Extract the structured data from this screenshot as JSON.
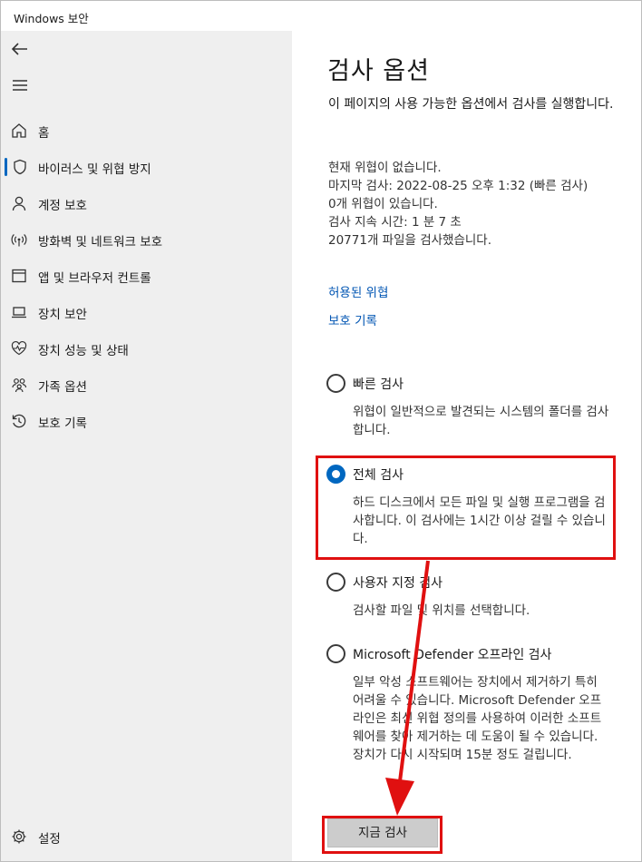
{
  "window": {
    "title": "Windows 보안"
  },
  "sidebar": {
    "back_icon": "back-arrow-icon",
    "menu_icon": "hamburger-menu-icon",
    "items": [
      {
        "label": "홈",
        "icon": "home-icon"
      },
      {
        "label": "바이러스 및 위협 방지",
        "icon": "shield-icon",
        "active": true
      },
      {
        "label": "계정 보호",
        "icon": "person-icon"
      },
      {
        "label": "방화벽 및 네트워크 보호",
        "icon": "wifi-antenna-icon"
      },
      {
        "label": "앱 및 브라우저 컨트롤",
        "icon": "app-window-icon"
      },
      {
        "label": "장치 보안",
        "icon": "laptop-icon"
      },
      {
        "label": "장치 성능 및 상태",
        "icon": "heart-pulse-icon"
      },
      {
        "label": "가족 옵션",
        "icon": "family-icon"
      },
      {
        "label": "보호 기록",
        "icon": "history-icon"
      }
    ],
    "settings_label": "설정",
    "accent_color": "#0067c0"
  },
  "main": {
    "title": "검사 옵션",
    "description": "이 페이지의 사용 가능한 옵션에서 검사를 실행합니다.",
    "status_lines": [
      "현재 위협이 없습니다.",
      "마지막 검사: 2022-08-25 오후 1:32 (빠른 검사)",
      "0개 위협이 있습니다.",
      "검사 지속 시간: 1 분 7 초",
      "20771개 파일을 검사했습니다."
    ],
    "links": {
      "allowed_threats": "허용된 위협",
      "protection_history": "보호 기록"
    },
    "options": [
      {
        "label": "빠른 검사",
        "description": "위협이 일반적으로 발견되는 시스템의 폴더를 검사합니다.",
        "selected": false
      },
      {
        "label": "전체 검사",
        "description": "하드 디스크에서 모든 파일 및 실행 프로그램을 검사합니다. 이 검사에는 1시간 이상 걸릴 수 있습니다.",
        "selected": true
      },
      {
        "label": "사용자 지정 검사",
        "description": "검사할 파일 및 위치를 선택합니다.",
        "selected": false
      },
      {
        "label": "Microsoft Defender 오프라인 검사",
        "description": "일부 악성 소프트웨어는 장치에서 제거하기 특히 어려울 수 있습니다. Microsoft Defender 오프라인은 최신 위협 정의를 사용하여 이러한 소프트웨어를 찾아 제거하는 데 도움이 될 수 있습니다. 장치가 다시 시작되며 15분 정도 걸립니다.",
        "selected": false
      }
    ],
    "scan_button_label": "지금 검사"
  },
  "annotation_color": "#e01010"
}
